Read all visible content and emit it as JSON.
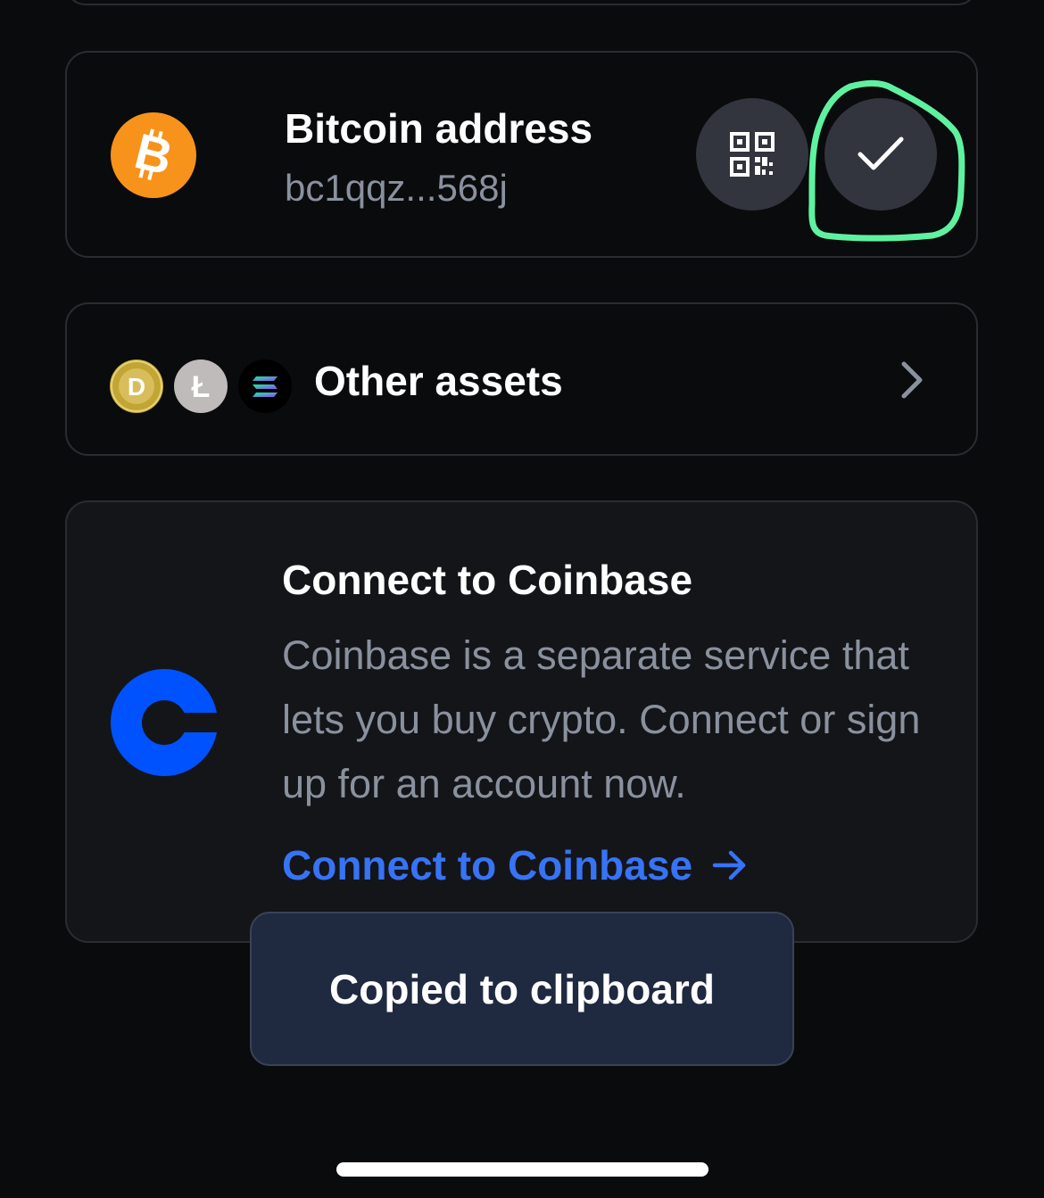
{
  "bitcoin_card": {
    "title": "Bitcoin address",
    "address": "bc1qqz...568j",
    "logo_icon": "bitcoin-icon",
    "logo_color": "#f7931a",
    "qr_button_icon": "qr-code-icon",
    "copy_button_icon": "checkmark-icon"
  },
  "other_assets_card": {
    "title": "Other assets",
    "asset_icons": [
      "dogecoin-icon",
      "litecoin-icon",
      "solana-icon"
    ],
    "chevron_icon": "chevron-right-icon"
  },
  "coinbase_card": {
    "title": "Connect to Coinbase",
    "description": "Coinbase is a separate service that lets you buy crypto. Connect or sign up for an account now.",
    "link_label": "Connect to Coinbase",
    "link_icon": "arrow-right-icon",
    "logo_icon": "coinbase-icon",
    "brand_color": "#0052ff",
    "link_color": "#3773f5"
  },
  "toast": {
    "message": "Copied to clipboard"
  },
  "annotation": {
    "color": "#5ef2a0"
  }
}
